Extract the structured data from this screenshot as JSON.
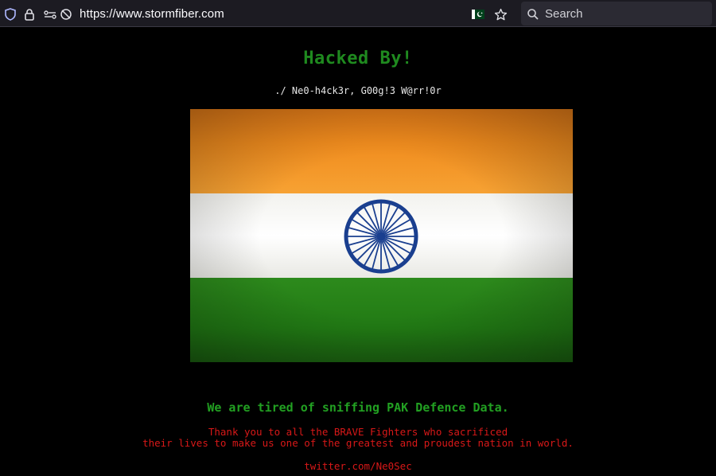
{
  "browser": {
    "url": "https://www.stormfiber.com",
    "search_placeholder": "Search",
    "icons": [
      "shield-icon",
      "lock-icon",
      "permissions-icon",
      "tracking-protection-off-icon",
      "pakistan-flag-icon",
      "bookmark-star-icon",
      "search-icon"
    ]
  },
  "page": {
    "heading": "Hacked By!",
    "author_line": "./ Ne0-h4ck3r, G00g!3 W@rr!0r",
    "flag_image": "india-flag",
    "message": "We are tired of sniffing PAK Defence Data.",
    "thanks_line1": "Thank you to all the BRAVE Fighters who sacrificed",
    "thanks_line2": "their lives to make us one of the greatest and proudest nation in world.",
    "contact": "twitter.com/Ne0Sec"
  },
  "colors": {
    "heading": "#1f8a1f",
    "message": "#22a022",
    "red_text": "#d81818",
    "saffron": "#f08c1e",
    "green": "#217a14",
    "chakra_blue": "#1a3f8f"
  }
}
